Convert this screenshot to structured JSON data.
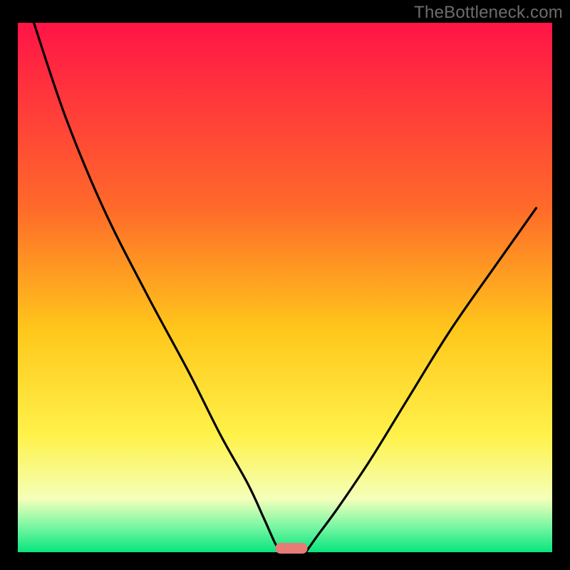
{
  "watermark": "TheBottleneck.com",
  "colors": {
    "top": "#ff1447",
    "mid_upper": "#ff6a2a",
    "mid": "#ffc71b",
    "mid_lower": "#fff24a",
    "pale": "#f4ffba",
    "green_light": "#7cf7a4",
    "green": "#08e57d",
    "curve": "#000000",
    "marker_fill": "#e67b77",
    "marker_stroke": "#d65a57",
    "background": "#000000"
  },
  "chart_data": {
    "type": "line",
    "title": "",
    "xlabel": "",
    "ylabel": "",
    "xlim": [
      0,
      100
    ],
    "ylim": [
      0,
      100
    ],
    "note": "Values estimated from pixel positions; no axes or tick labels are rendered in the image.",
    "series": [
      {
        "name": "left-branch",
        "x": [
          3.0,
          9.0,
          16.0,
          24.0,
          32.0,
          38.0,
          43.0,
          46.0,
          48.0,
          49.1
        ],
        "y": [
          100.0,
          82.0,
          65.0,
          49.0,
          34.0,
          22.0,
          13.0,
          6.5,
          2.0,
          0.0
        ]
      },
      {
        "name": "right-branch",
        "x": [
          53.9,
          56.0,
          60.0,
          66.0,
          73.0,
          81.0,
          90.0,
          97.0
        ],
        "y": [
          0.0,
          3.0,
          8.5,
          17.5,
          29.0,
          42.0,
          55.0,
          65.0
        ]
      }
    ],
    "marker": {
      "name": "optimal-zone",
      "shape": "pill",
      "x_center": 51.2,
      "width": 6.0,
      "y": 0.0
    }
  }
}
